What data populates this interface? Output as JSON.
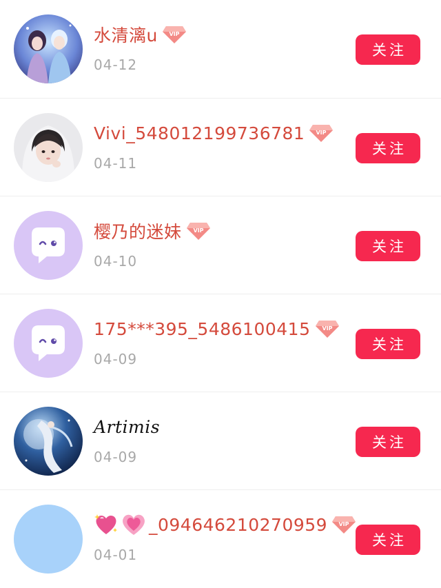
{
  "colors": {
    "accent": "#f6284f",
    "vip_name": "#d44a3c",
    "date": "#a8a8a8",
    "default_avatar_bg": "#d9c6f6",
    "blank_avatar_bg": "#a8d2fa"
  },
  "users": [
    {
      "name": "水清漓u",
      "date": "04-12",
      "vip": true,
      "follow_label": "关注",
      "avatar": "anime-couple-avatar"
    },
    {
      "name": "Vivi_548012199736781",
      "date": "04-11",
      "vip": true,
      "follow_label": "关注",
      "avatar": "girl-photo-avatar"
    },
    {
      "name": "樱乃的迷妹",
      "date": "04-10",
      "vip": true,
      "follow_label": "关注",
      "avatar": "default-chat-avatar"
    },
    {
      "name": "175***395_5486100415",
      "date": "04-09",
      "vip": true,
      "follow_label": "关注",
      "avatar": "default-chat-avatar"
    },
    {
      "name": "Artimis",
      "date": "04-09",
      "vip": false,
      "follow_label": "关注",
      "avatar": "moon-fantasy-avatar"
    },
    {
      "name_prefix_icons": [
        "sparkling-heart-icon",
        "growing-heart-icon"
      ],
      "name": "_094646210270959",
      "date": "04-01",
      "vip": true,
      "follow_label": "关注",
      "avatar": "blank-blue-avatar"
    }
  ],
  "vip_badge_text": "VIP"
}
